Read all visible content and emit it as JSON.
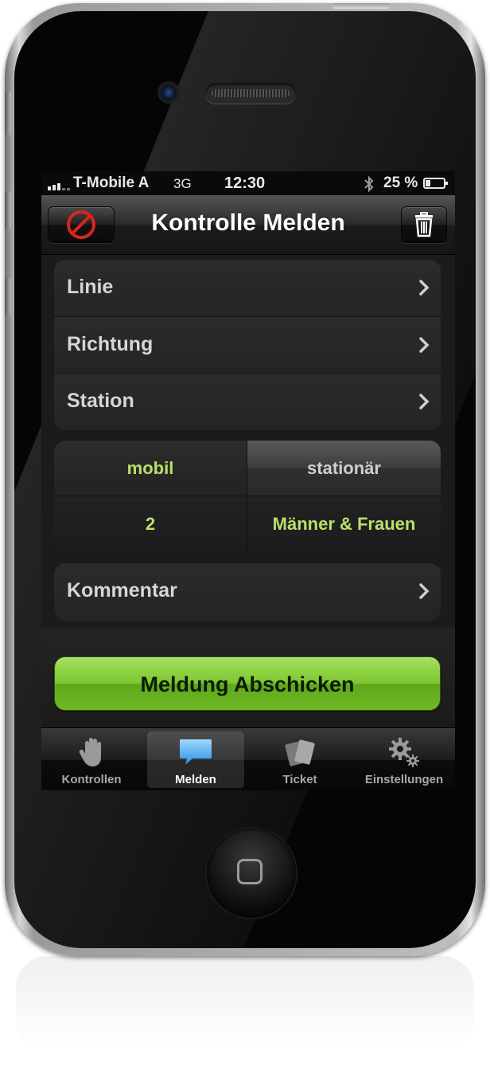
{
  "status_bar": {
    "carrier": "T-Mobile A",
    "network": "3G",
    "time": "12:30",
    "battery": "25 %"
  },
  "nav_bar": {
    "title": "Kontrolle Melden",
    "left_icon": "prohibited-icon",
    "right_icon": "trash-icon"
  },
  "location_group": {
    "rows": [
      {
        "label": "Linie"
      },
      {
        "label": "Richtung"
      },
      {
        "label": "Station"
      }
    ]
  },
  "type_segment": {
    "options": [
      "mobil",
      "stationär"
    ],
    "selected": "mobil",
    "count_value": "2",
    "gender_value": "Männer & Frauen"
  },
  "comment_group": {
    "label": "Kommentar"
  },
  "submit_button": {
    "label": "Meldung Abschicken"
  },
  "tab_bar": {
    "tabs": [
      {
        "label": "Kontrollen",
        "icon": "hand-icon"
      },
      {
        "label": "Melden",
        "icon": "speech-bubble-icon"
      },
      {
        "label": "Ticket",
        "icon": "ticket-icon"
      },
      {
        "label": "Einstellungen",
        "icon": "gears-icon"
      }
    ],
    "active": "Melden"
  },
  "colors": {
    "accent_green": "#b9e06a",
    "button_green": "#7cc630"
  }
}
